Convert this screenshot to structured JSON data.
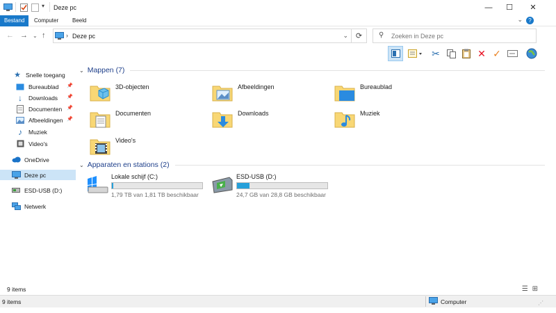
{
  "window": {
    "title": "Deze pc",
    "controls": {
      "minimize": "—",
      "maximize": "☐",
      "close": "✕"
    }
  },
  "ribbon": {
    "tabs": [
      "Bestand",
      "Computer",
      "Beeld"
    ],
    "active_tab": "Bestand",
    "help": "?"
  },
  "address": {
    "path": "Deze pc",
    "search_placeholder": "Zoeken in Deze pc"
  },
  "toolbar": {
    "icons": [
      "preview-pane-icon",
      "layout-icon",
      "cut-icon",
      "copy-icon",
      "paste-icon",
      "delete-icon",
      "check-icon",
      "rename-icon",
      "globe-icon"
    ]
  },
  "nav": {
    "quick_access": "Snelle toegang",
    "items": [
      {
        "label": "Bureaublad",
        "pinned": true
      },
      {
        "label": "Downloads",
        "pinned": true
      },
      {
        "label": "Documenten",
        "pinned": true
      },
      {
        "label": "Afbeeldingen",
        "pinned": true
      },
      {
        "label": "Muziek",
        "pinned": false
      },
      {
        "label": "Video's",
        "pinned": false
      }
    ],
    "onedrive": "OneDrive",
    "this_pc": "Deze pc",
    "usb": "ESD-USB (D:)",
    "network": "Netwerk"
  },
  "content": {
    "folders_header": "Mappen (7)",
    "folders": [
      "3D-objecten",
      "Afbeeldingen",
      "Bureaublad",
      "Documenten",
      "Downloads",
      "Muziek",
      "Video's"
    ],
    "drives_header": "Apparaten en stations (2)",
    "drives": [
      {
        "name": "Lokale schijf (C:)",
        "free": "1,79 TB van 1,81 TB beschikbaar",
        "used_fraction": 0.012
      },
      {
        "name": "ESD-USB (D:)",
        "free": "24,7 GB van 28,8 GB beschikbaar",
        "used_fraction": 0.142
      }
    ]
  },
  "status": {
    "items_count": "9 items",
    "items_count_bottom": "9 items",
    "zone": "Computer"
  },
  "colors": {
    "accent": "#1979ca",
    "selection": "#cce4f7",
    "group_header": "#1e3f8a",
    "drive_bar": "#26a0da",
    "folder": "#f8d775"
  }
}
